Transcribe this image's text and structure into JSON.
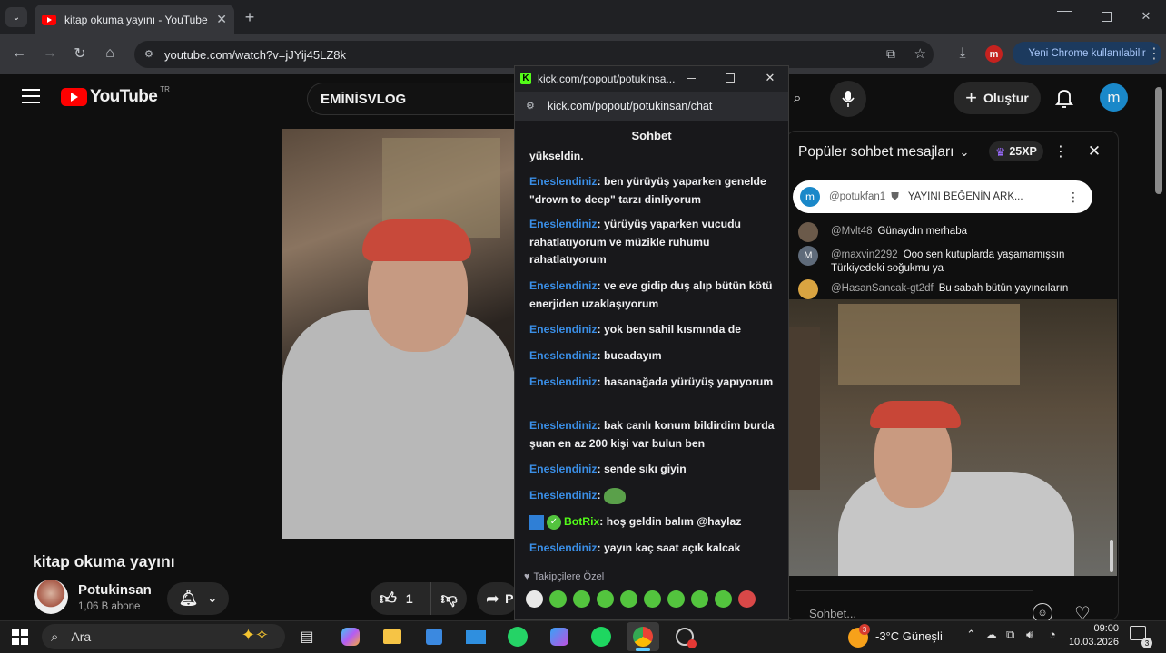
{
  "browser": {
    "tab_title": "kitap okuma yayını - YouTube",
    "url": "youtube.com/watch?v=jJYij45LZ8k",
    "profile_initial": "m",
    "update_button": "Yeni Chrome kullanılabilir"
  },
  "youtube": {
    "logo_text": "YouTube",
    "logo_region": "TR",
    "search_value": "EMİNİSVLOG",
    "create_label": "Oluştur",
    "avatar_initial": "m",
    "video_title": "kitap okuma yayını",
    "channel_name": "Potukinsan",
    "subscribers": "1,06 B abone",
    "like_count": "1",
    "share_partial": "P"
  },
  "kick_popup": {
    "title": "kick.com/popout/potukinsa...",
    "url": "kick.com/popout/potukinsan/chat",
    "header": "Sohbet",
    "top_fragment": "yükseldin.",
    "messages": [
      {
        "user": "Eneslendiniz",
        "text": "ben yürüyüş yaparken genelde \"drown to deep\" tarzı dinliyorum"
      },
      {
        "user": "Eneslendiniz",
        "text": "yürüyüş yaparken vucudu rahatlatıyorum ve müzikle ruhumu rahatlatıyorum"
      },
      {
        "user": "Eneslendiniz",
        "text": "ve eve gidip duş alıp bütün kötü enerjiden uzaklaşıyorum"
      },
      {
        "user": "Eneslendiniz",
        "text": "yok ben sahil kısmında de"
      },
      {
        "user": "Eneslendiniz",
        "text": "bucadayım"
      },
      {
        "user": "Eneslendiniz",
        "text": "hasanağada yürüyüş yapıyorum"
      },
      {
        "user": "Eneslendiniz",
        "text": "bak canlı konum bildirdim burda şuan en az 200 kişi var bulun ben"
      },
      {
        "user": "Eneslendiniz",
        "text": "sende sıkı giyin"
      },
      {
        "user": "Eneslendiniz",
        "text": ""
      },
      {
        "user": "BotRix",
        "text": "hoş geldin balım @haylaz"
      },
      {
        "user": "Eneslendiniz",
        "text": "yayın kaç saat açık kalcak"
      }
    ],
    "followers_only": "Takipçilere Özel"
  },
  "live_chat": {
    "header": "Popüler sohbet mesajları",
    "xp": "25XP",
    "pinned_user": "@potukfan1",
    "pinned_text": "YAYINI BEĞENİN ARK...",
    "messages": [
      {
        "user": "@Mvlt48",
        "text": "Günaydın merhaba",
        "avatar": "#6b5a4a"
      },
      {
        "user": "@maxvin2292",
        "text": "Ooo sen kutuplarda yaşamamışsın Türkiyedeki soğukmu ya",
        "avatar": "#5f6b7a"
      },
      {
        "user": "@HasanSancak-gt2df",
        "text": "Bu sabah bütün yayıncıların",
        "avatar": "#d9a441"
      }
    ],
    "input_placeholder": "Sohbet..."
  },
  "taskbar": {
    "search_placeholder": "Ara",
    "weather": "-3°C Güneşli",
    "weather_badge": "3",
    "time": "09:00",
    "date": "10.03.2026",
    "notif_count": "3"
  },
  "colors": {
    "kick_user": "#3a8ee6",
    "kick_green": "#53fc18",
    "yt_red": "#ff0000"
  }
}
